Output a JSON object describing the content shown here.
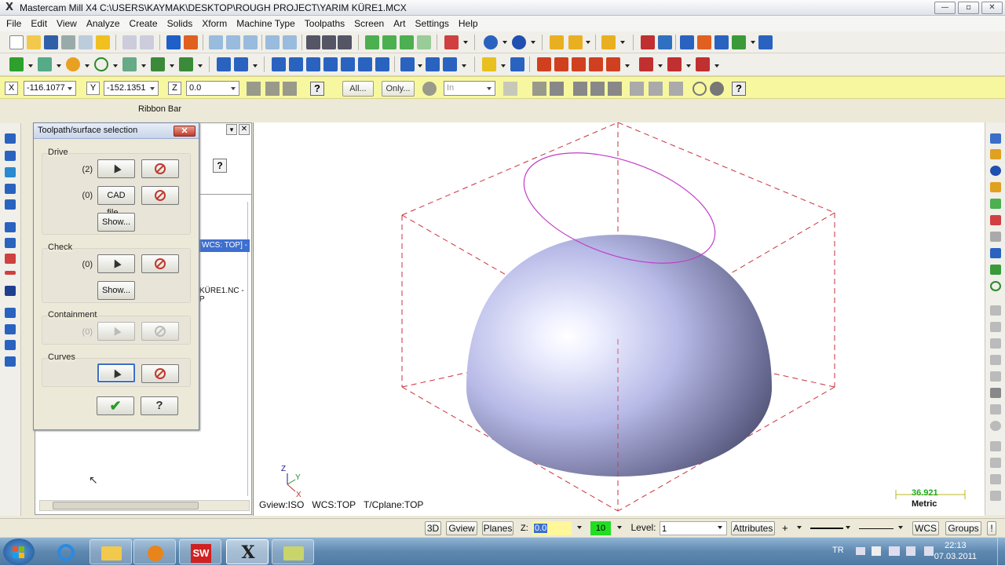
{
  "window": {
    "title": "Mastercam Mill X4  C:\\USERS\\KAYMAK\\DESKTOP\\ROUGH PROJECT\\YARIM KÜRE1.MCX",
    "logo": "X",
    "minimize": "—",
    "restore": "▫",
    "close": "✕"
  },
  "menu": [
    "File",
    "Edit",
    "View",
    "Analyze",
    "Create",
    "Solids",
    "Xform",
    "Machine Type",
    "Toolpaths",
    "Screen",
    "Art",
    "Settings",
    "Help"
  ],
  "ribbon": {
    "x_label": "X",
    "x_value": "-116.1077",
    "y_label": "Y",
    "y_value": "-152.1351",
    "z_label": "Z",
    "z_value": "0.0",
    "all_button": "All...",
    "only_button": "Only...",
    "mask_value": "In",
    "caption": "Ribbon Bar"
  },
  "dialog": {
    "title": "Toolpath/surface selection",
    "close": "✕",
    "groups": {
      "drive": {
        "label": "Drive",
        "count1": "(2)",
        "count2": "(0)",
        "cad_button": "CAD file...",
        "show_button": "Show..."
      },
      "check": {
        "label": "Check",
        "count": "(0)",
        "show_button": "Show..."
      },
      "containment": {
        "label": "Containment",
        "count": "(0)"
      },
      "curves": {
        "label": "Curves"
      }
    },
    "ok_glyph": "✔",
    "help_glyph": "?"
  },
  "panel": {
    "wcs_text": "WCS: TOP] -",
    "nc_text": "KÜRE1.NC - P",
    "help_glyph": "?"
  },
  "viewport": {
    "gview": "Gview:ISO",
    "wcs": "WCS:TOP",
    "tplane": "T/Cplane:TOP",
    "scale_value": "36.921",
    "units": "Metric",
    "axis_z": "Z",
    "axis_y": "Y",
    "axis_x": "X"
  },
  "statusbar": {
    "btn_3d": "3D",
    "gview": "Gview",
    "planes": "Planes",
    "z_label": "Z:",
    "z_value": "0.0",
    "color_value": "10",
    "level_label": "Level:",
    "level_value": "1",
    "attributes": "Attributes",
    "wcs": "WCS",
    "groups": "Groups",
    "extra": "!"
  },
  "taskbar": {
    "lang": "TR",
    "time": "22:13",
    "date": "07.03.2011",
    "sw_label": "SW",
    "x_label": "X"
  },
  "colors": {
    "accent_blue": "#3a6ec8",
    "ribbon_yellow": "#f7f7a0",
    "wire_red": "#c8323c",
    "curve_magenta": "#c23cc8",
    "scale_green": "#1faa1f"
  }
}
